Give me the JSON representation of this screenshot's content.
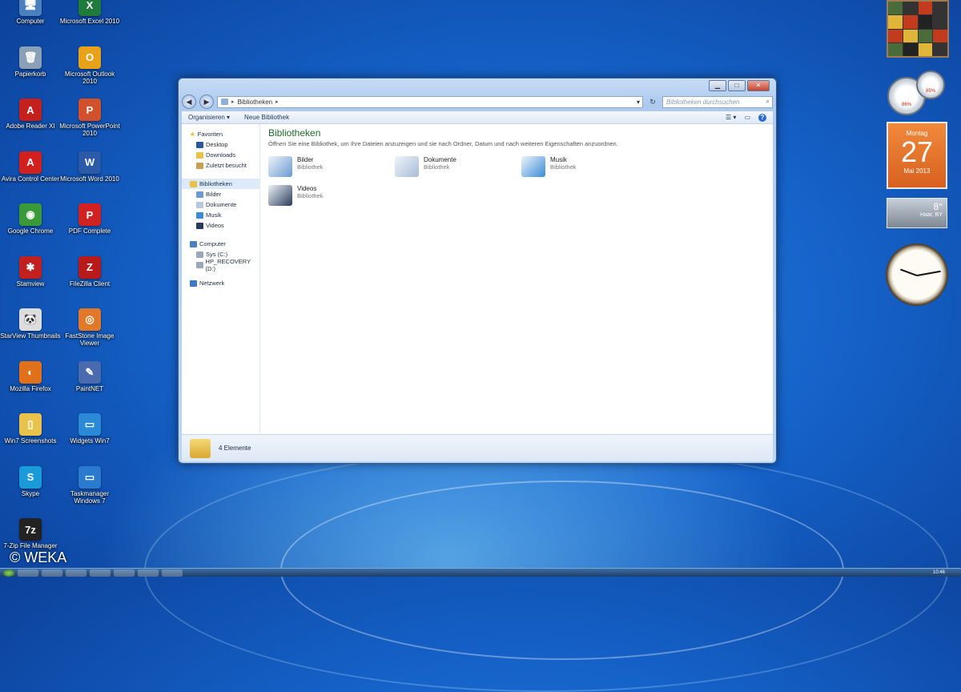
{
  "desktop": {
    "icons": [
      {
        "label": "Computer",
        "color": "#4a7fc0",
        "glyph": "🖥"
      },
      {
        "label": "Microsoft Excel 2010",
        "color": "#1e7b3c",
        "glyph": "X"
      },
      {
        "label": "Papierkorb",
        "color": "#8aa0b8",
        "glyph": "🗑"
      },
      {
        "label": "Microsoft Outlook 2010",
        "color": "#e8a21a",
        "glyph": "O"
      },
      {
        "label": "Adobe Reader XI",
        "color": "#c3201e",
        "glyph": "A"
      },
      {
        "label": "Microsoft PowerPoint 2010",
        "color": "#d2502a",
        "glyph": "P"
      },
      {
        "label": "Avira Control Center",
        "color": "#d2201e",
        "glyph": "A"
      },
      {
        "label": "Microsoft Word 2010",
        "color": "#2a5aa8",
        "glyph": "W"
      },
      {
        "label": "Google Chrome",
        "color": "#3a9a3a",
        "glyph": "◉"
      },
      {
        "label": "PDF Complete",
        "color": "#d02222",
        "glyph": "P"
      },
      {
        "label": "Stamview",
        "color": "#c22020",
        "glyph": "✱"
      },
      {
        "label": "FileZilla Client",
        "color": "#b81a1a",
        "glyph": "Z"
      },
      {
        "label": "StarView Thumbnails",
        "color": "#ddd",
        "glyph": "🐼"
      },
      {
        "label": "FastStone Image Viewer",
        "color": "#e07a2a",
        "glyph": "◎"
      },
      {
        "label": "Mozilla Firefox",
        "color": "#e0701a",
        "glyph": "◐"
      },
      {
        "label": "PaintNET",
        "color": "#4a6ab0",
        "glyph": "✎"
      },
      {
        "label": "Win7 Screenshots",
        "color": "#e8c24a",
        "glyph": "▯"
      },
      {
        "label": "Widgets Win7",
        "color": "#2a8ad8",
        "glyph": "▭"
      },
      {
        "label": "Skype",
        "color": "#1a9ad8",
        "glyph": "S"
      },
      {
        "label": "Taskmanager Windows 7",
        "color": "#2a7ad0",
        "glyph": "▭"
      },
      {
        "label": "7-Zip File Manager",
        "color": "#222",
        "glyph": "7z"
      }
    ]
  },
  "window": {
    "controls": {
      "minimize": "▁",
      "maximize": "□",
      "close": "✕"
    },
    "nav": {
      "back": "◀",
      "forward": "▶"
    },
    "address": {
      "root_chevron": "▸",
      "path": "Bibliotheken",
      "path_chevron": "▸",
      "dropdown": "▾",
      "refresh": "↻"
    },
    "search": {
      "placeholder": "Bibliotheken durchsuchen",
      "icon": "⌕"
    },
    "commands": {
      "organize": "Organisieren ▾",
      "new_library": "Neue Bibliothek",
      "views": "☰ ▾",
      "preview": "▭",
      "help": "?"
    },
    "navpane": {
      "favorites": "Favoriten",
      "desktop": "Desktop",
      "downloads": "Downloads",
      "recent": "Zuletzt besucht",
      "libraries": "Bibliotheken",
      "pictures": "Bilder",
      "documents": "Dokumente",
      "music": "Musik",
      "videos": "Videos",
      "computer": "Computer",
      "drive_c": "Sys (C:)",
      "drive_d": "HP_RECOVERY (D:)",
      "network": "Netzwerk"
    },
    "main": {
      "title": "Bibliotheken",
      "description": "Öffnen Sie eine Bibliothek, um Ihre Dateien anzuzeigen und sie nach Ordner, Datum und nach weiteren Eigenschaften anzuordnen.",
      "libraries": [
        {
          "name": "Bilder",
          "type": "Bibliothek",
          "color": "#6a9ad0"
        },
        {
          "name": "Dokumente",
          "type": "Bibliothek",
          "color": "#a8bcd6"
        },
        {
          "name": "Musik",
          "type": "Bibliothek",
          "color": "#3a8ad8"
        },
        {
          "name": "Videos",
          "type": "Bibliothek",
          "color": "#2a3a5a"
        }
      ]
    },
    "details": {
      "count": "4 Elemente"
    }
  },
  "gadgets": {
    "meter_cpu": "86%",
    "meter_ram": "85%",
    "calendar": {
      "day": "Montag",
      "date": "27",
      "month": "Mai 2013"
    },
    "weather": {
      "temp": "8°",
      "location": "Haar, BY"
    }
  },
  "taskbar": {
    "time": "10:46"
  },
  "watermark": "© WEKA"
}
